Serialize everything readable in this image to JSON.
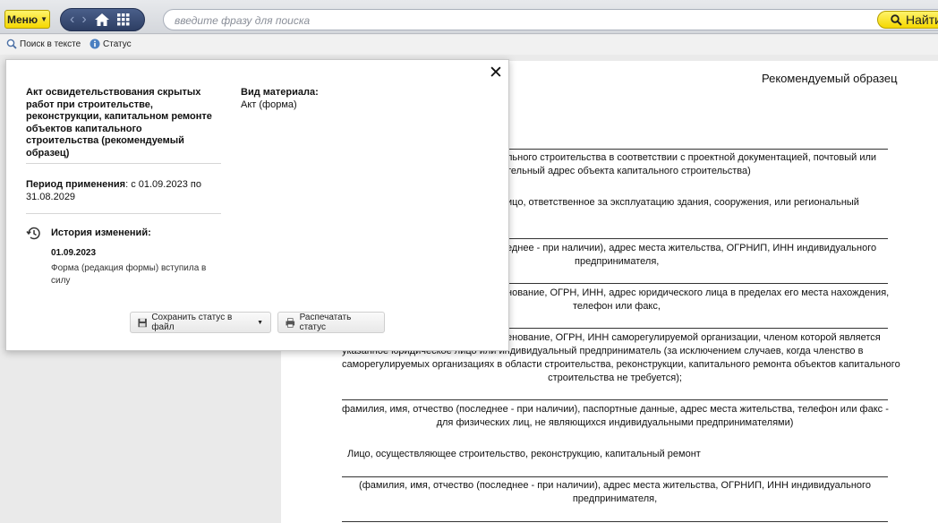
{
  "toolbar": {
    "menu_label": "Меню",
    "search_placeholder": "введите фразу для поиска",
    "find_label": "Найти"
  },
  "subbar": {
    "search_in_text": "Поиск в тексте",
    "status": "Статус"
  },
  "popup": {
    "title": "Акт освидетельствования скрытых работ при строительстве, реконструкции, капитальном ремонте объектов капитального строительства (рекомендуемый образец)",
    "period_label": "Период применения",
    "period_value": ": с 01.09.2023 по 31.08.2029",
    "history_title": "История изменений:",
    "history_date": "01.09.2023",
    "history_desc": "Форма (редакция формы) вступила в силу",
    "kind_label": "Вид материала:",
    "kind_value": "Акт (форма)",
    "save_button": "Сохранить статус в файл",
    "print_button": "Распечатать статус"
  },
  "document": {
    "sample_label": "Рекомендуемый образец",
    "fragments": [
      "льного строительства в соответствии с проектной документацией, почтовый или",
      "тельный адрес объекта капитального строительства)",
      "ицо, ответственное за эксплуатацию здания, сооружения, или региональный",
      "еднее - при наличии), адрес места жительства, ОГРНИП, ИНН индивидуального",
      "предпринимателя,",
      "нование, ОГРН, ИНН, адрес юридического лица в пределах его места нахождения,",
      "телефон или факс,",
      "енование, ОГРН, ИНН саморегулируемой организации, членом которой является",
      "указанное юридическое лицо или индивидуальный предприниматель (за исключением случаев, когда членство в",
      "саморегулируемых организациях в области строительства, реконструкции, капитального ремонта объектов капитального",
      "строительства не требуется);",
      "фамилия, имя, отчество (последнее - при наличии), паспортные данные, адрес места жительства, телефон или факс -",
      "для физических лиц, не являющихся индивидуальными предпринимателями)",
      "Лицо, осуществляющее строительство, реконструкцию, капитальный ремонт",
      "(фамилия, имя, отчество (последнее - при наличии), адрес места жительства, ОГРНИП, ИНН индивидуального",
      "предпринимателя,"
    ]
  }
}
